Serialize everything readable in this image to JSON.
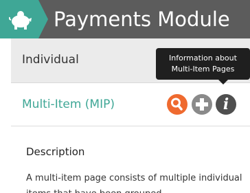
{
  "header": {
    "title": "Payments Module",
    "logo_icon": "piggy-bank-icon",
    "colors": {
      "bar": "#5c5c5c",
      "accent": "#3fa796"
    }
  },
  "options": {
    "individual_label": "Individual",
    "mip_label": "Multi-Item (MIP)",
    "mip_color": "#3fa796"
  },
  "actions": {
    "search_icon": "search-icon",
    "search_color": "#ef6a2f",
    "add_icon": "add-icon",
    "add_color": "#8a8a8a",
    "info_icon": "info-icon",
    "info_glyph": "i",
    "info_color": "#4f4f4f"
  },
  "tooltip": {
    "line1": "Information about",
    "line2": "Multi-Item Pages"
  },
  "description": {
    "heading": "Description",
    "body": "A multi-item page consists of multiple individual items that have been grouped"
  }
}
